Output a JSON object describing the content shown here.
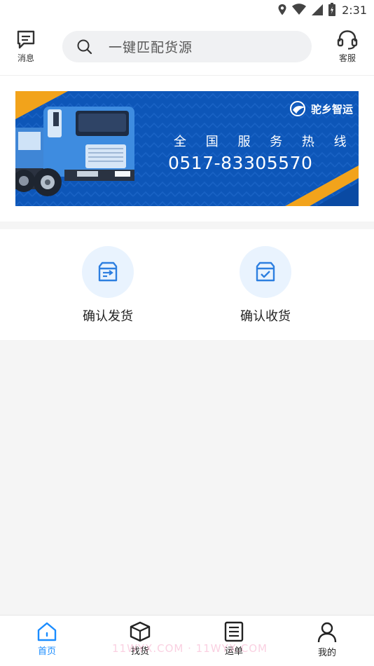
{
  "status_bar": {
    "time": "2:31"
  },
  "header": {
    "messages_label": "消息",
    "search_placeholder": "一键匹配货源",
    "service_label": "客服"
  },
  "banner": {
    "brand": "驼乡智运",
    "hotline_title": "全 国 服 务 热 线",
    "phone": "0517-83305570"
  },
  "actions": {
    "confirm_ship": "确认发货",
    "confirm_receive": "确认收货"
  },
  "tabs": [
    {
      "label": "首页",
      "icon": "home-icon"
    },
    {
      "label": "找货",
      "icon": "box-icon"
    },
    {
      "label": "运单",
      "icon": "waybill-icon"
    },
    {
      "label": "我的",
      "icon": "user-icon"
    }
  ],
  "watermark": "11WYX.COM · 11WYX.COM",
  "colors": {
    "accent": "#1a8cff",
    "banner_blue": "#0d56b8",
    "banner_orange": "#f2a31b"
  }
}
